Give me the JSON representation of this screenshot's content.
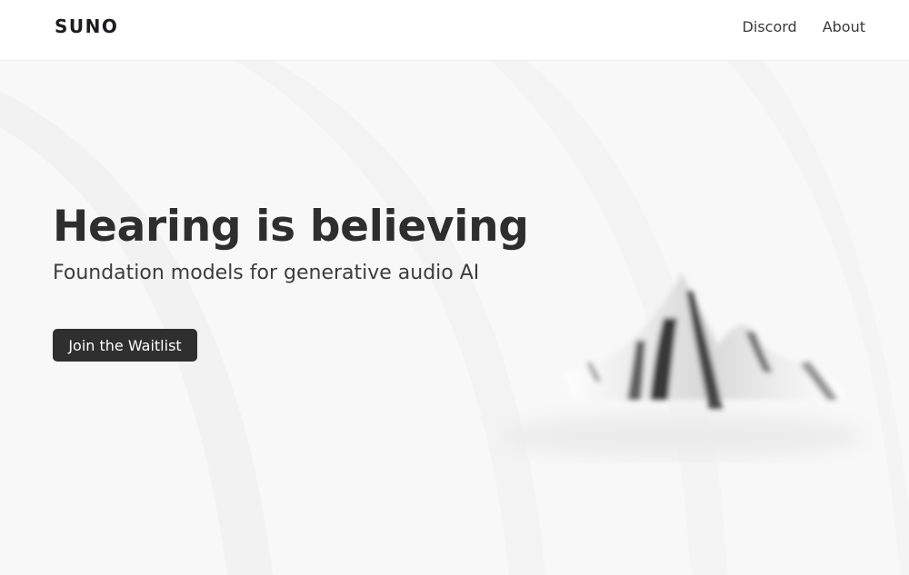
{
  "brand": {
    "logo_text": "SUNO"
  },
  "nav": {
    "items": [
      {
        "label": "Discord"
      },
      {
        "label": "About"
      }
    ]
  },
  "hero": {
    "title": "Hearing is believing",
    "subtitle": "Foundation models for generative audio AI",
    "cta_label": "Join the Waitlist"
  },
  "colors": {
    "page_background": "#f7f7f7",
    "header_background": "#ffffff",
    "button_background": "#2f2f2f",
    "text_primary": "#2e2e2e"
  }
}
